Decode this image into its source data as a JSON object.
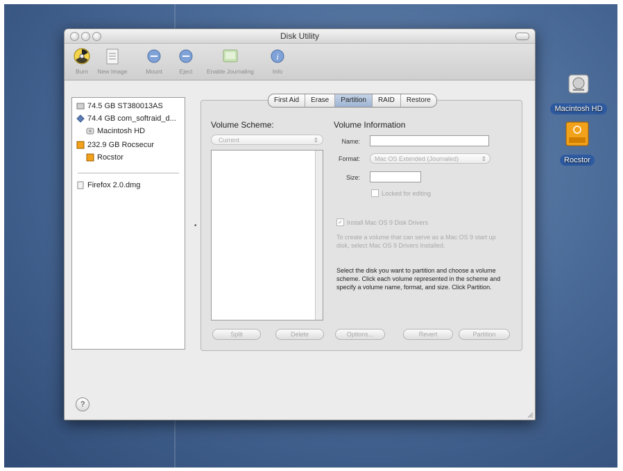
{
  "window": {
    "title": "Disk Utility"
  },
  "toolbar": {
    "items": [
      {
        "label": "Burn",
        "icon": "burn-icon"
      },
      {
        "label": "New Image",
        "icon": "new-image-icon"
      },
      {
        "label": "Mount",
        "icon": "mount-icon"
      },
      {
        "label": "Eject",
        "icon": "eject-icon"
      },
      {
        "label": "Enable Journaling",
        "icon": "journaling-icon"
      },
      {
        "label": "Info",
        "icon": "info-icon"
      }
    ]
  },
  "disks": [
    {
      "label": "74.5 GB ST380013AS",
      "icon": "hard-drive-icon"
    },
    {
      "label": "74.4 GB com_softraid_d...",
      "icon": "raid-drive-icon"
    },
    {
      "label": "Macintosh HD",
      "icon": "volume-icon"
    },
    {
      "label": "232.9 GB Rocsecur",
      "icon": "firewire-drive-icon"
    },
    {
      "label": "Rocstor",
      "icon": "firewire-volume-icon"
    },
    {
      "label": "Firefox 2.0.dmg",
      "icon": "disk-image-icon"
    }
  ],
  "tabs": [
    "First Aid",
    "Erase",
    "Partition",
    "RAID",
    "Restore"
  ],
  "active_tab": "Partition",
  "volume_scheme": {
    "heading": "Volume Scheme:",
    "selected": "Current"
  },
  "volume_info": {
    "heading": "Volume Information",
    "name_label": "Name:",
    "name_value": "",
    "format_label": "Format:",
    "format_value": "Mac OS Extended (Journaled)",
    "size_label": "Size:",
    "size_value": "",
    "locked_label": "Locked for editing",
    "install_drivers_label": "Install Mac OS 9 Disk Drivers",
    "install_drivers_checked": true,
    "hint_gray": "To create a volume that can serve as a Mac OS 9 start up disk, select Mac OS 9 Drivers Installed.",
    "hint_dark": "Select the disk you want to partition and choose a volume scheme. Click each volume represented in the scheme and specify a volume name, format, and size. Click Partition."
  },
  "buttons": {
    "split": "Split",
    "delete": "Delete",
    "options": "Options...",
    "revert": "Revert",
    "partition": "Partition"
  },
  "help": "?",
  "desktop": {
    "icons": [
      {
        "label": "Macintosh HD",
        "icon": "macintosh-hd-icon"
      },
      {
        "label": "Rocstor",
        "icon": "rocstor-drive-icon"
      }
    ]
  },
  "colors": {
    "desktop": "#4b6b98",
    "selection": "#2d5aa0",
    "window": "#ececec"
  }
}
